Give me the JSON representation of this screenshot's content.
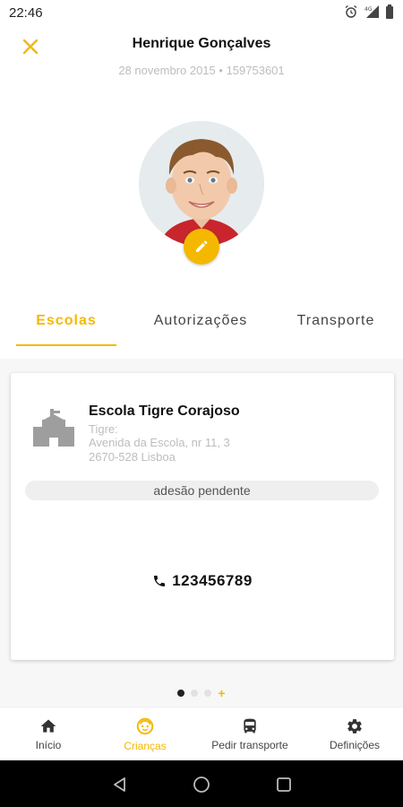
{
  "status_bar": {
    "time": "22:46",
    "icons": [
      "alarm-icon",
      "signal-4g-icon",
      "battery-icon"
    ]
  },
  "header": {
    "close_icon": "close-icon",
    "child_name": "Henrique Gonçalves",
    "birth_date": "28 novembro 2015",
    "separator": " • ",
    "child_id": "159753601"
  },
  "profile": {
    "edit_icon": "pencil-icon"
  },
  "tabs": [
    {
      "label": "Escolas",
      "active": true
    },
    {
      "label": "Autorizações",
      "active": false
    },
    {
      "label": "Transporte",
      "active": false
    }
  ],
  "school_card": {
    "icon": "school-building-icon",
    "name": "Escola Tigre Corajoso",
    "city": "Tigre:",
    "street": "Avenida da Escola, nr 11, 3",
    "postal": "2670-528 Lisboa",
    "status": "adesão pendente",
    "phone_icon": "phone-icon",
    "phone": "123456789"
  },
  "pager": {
    "count": 3,
    "active_index": 0,
    "add_symbol": "+"
  },
  "bottom_nav": [
    {
      "label": "Início",
      "icon": "home-icon",
      "active": false
    },
    {
      "label": "Crianças",
      "icon": "child-face-icon",
      "active": true
    },
    {
      "label": "Pedir transporte",
      "icon": "bus-icon",
      "active": false
    },
    {
      "label": "Definições",
      "icon": "gear-icon",
      "active": false
    }
  ],
  "system_nav": [
    "back-icon",
    "home-circle-icon",
    "recents-icon"
  ],
  "colors": {
    "accent": "#f5b800",
    "muted_text": "#bdbdbd",
    "pill_bg": "#efefef"
  }
}
